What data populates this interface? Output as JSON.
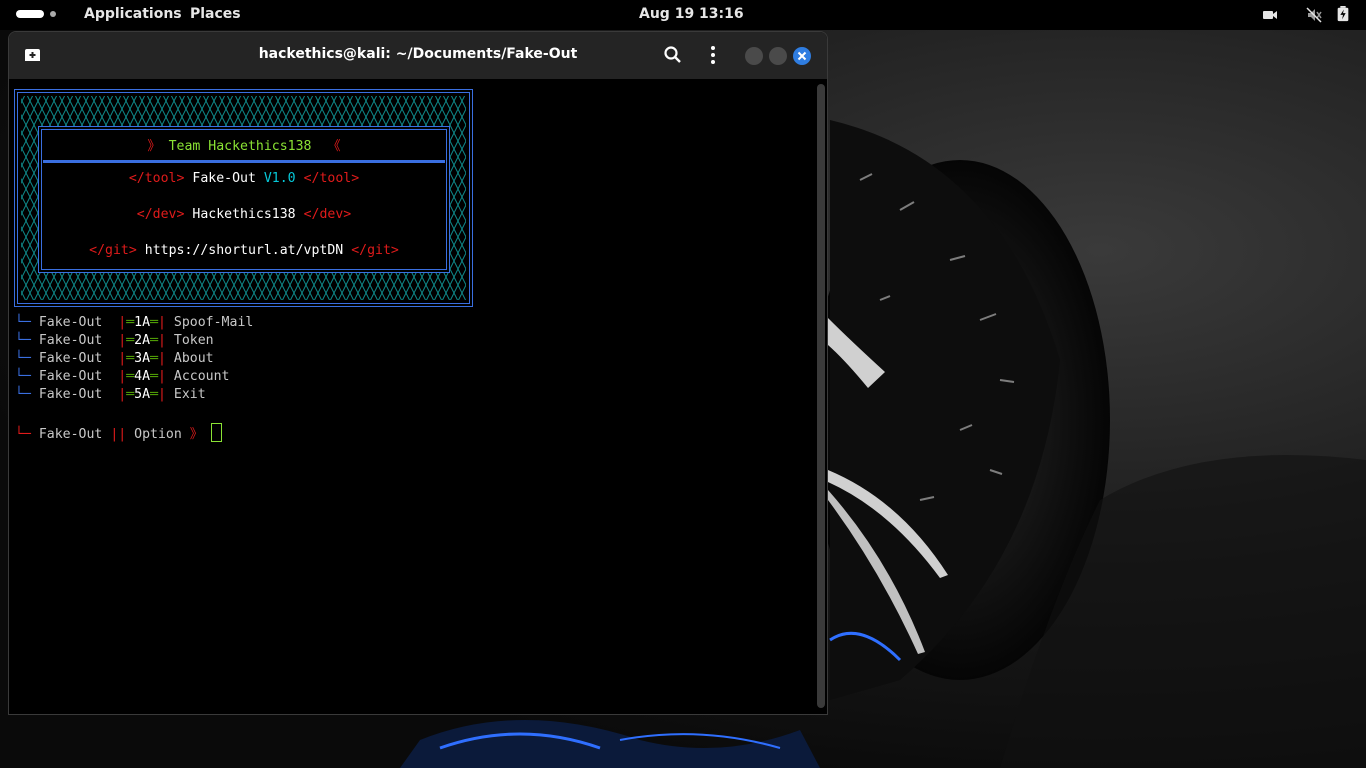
{
  "topbar": {
    "applications_label": "Applications",
    "places_label": "Places",
    "clock": "Aug 19  13:16"
  },
  "window": {
    "title": "hackethics@kali: ~/Documents/Fake-Out"
  },
  "banner": {
    "team_open": "》",
    "team_text": "Team Hackethics138",
    "team_close": "《",
    "tool_open": "</tool>",
    "tool_name": "Fake-Out",
    "tool_version": "V1.0",
    "tool_close": "</tool>",
    "dev_open": "</dev>",
    "dev_name": "Hackethics138",
    "dev_close": "</dev>",
    "git_open": "</git>",
    "git_url": "https://shorturl.at/vptDN",
    "git_close": "</git>"
  },
  "menu": {
    "prefix_glyph": "└─",
    "items": [
      {
        "tool": "Fake-Out",
        "code": "1A",
        "label": "Spoof-Mail"
      },
      {
        "tool": "Fake-Out",
        "code": "2A",
        "label": "Token"
      },
      {
        "tool": "Fake-Out",
        "code": "3A",
        "label": "About"
      },
      {
        "tool": "Fake-Out",
        "code": "4A",
        "label": "Account"
      },
      {
        "tool": "Fake-Out",
        "code": "5A",
        "label": "Exit"
      }
    ]
  },
  "prompt": {
    "prefix_glyph": "└─",
    "tool": "Fake-Out",
    "separator": "||",
    "label": "Option",
    "arrow": "》"
  },
  "colors": {
    "accent_blue": "#3a6fe0",
    "red": "#e01b1b",
    "green": "#8ae234",
    "cyan": "#06c8d8",
    "teal_pattern": "#0e8a8a",
    "close_button": "#2f7de1"
  },
  "icons": {
    "new_tab": "new-tab-icon",
    "search": "search-icon",
    "menu": "kebab-menu-icon",
    "camera": "camera-icon",
    "volume_muted": "volume-muted-icon",
    "battery": "battery-icon"
  }
}
